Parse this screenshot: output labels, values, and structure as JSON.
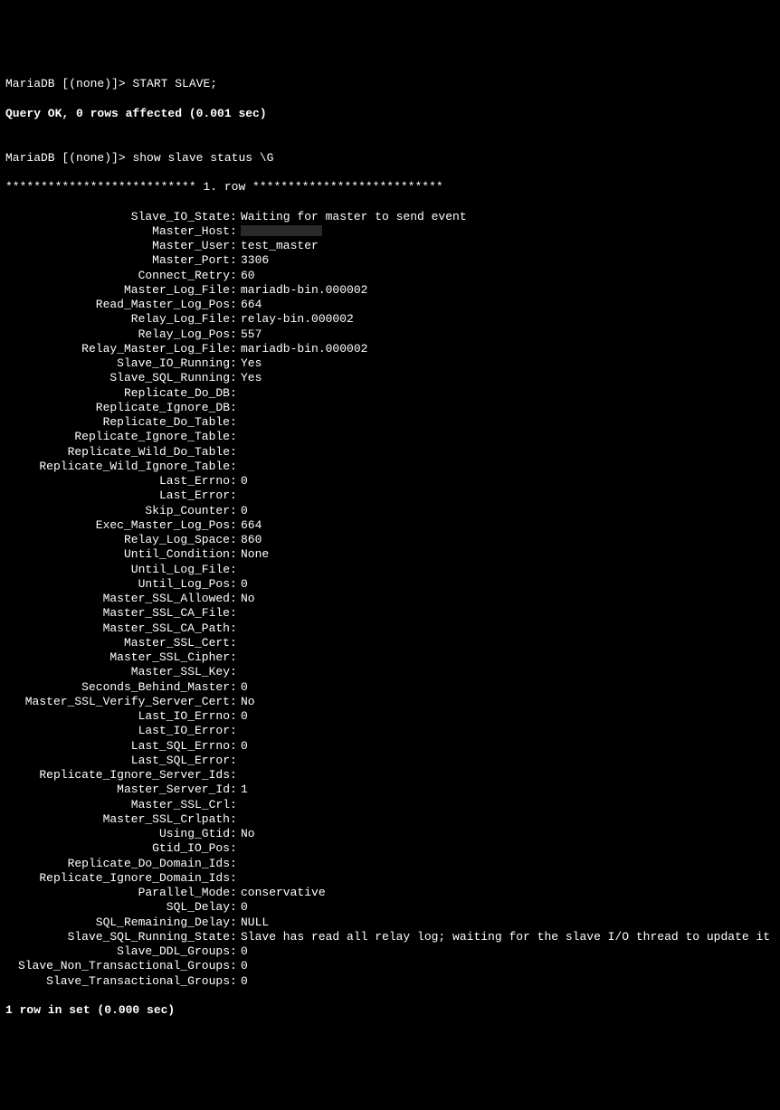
{
  "prompt1": "MariaDB [(none)]> ",
  "cmd1": "START SLAVE;",
  "result1": "Query OK, 0 rows affected (0.001 sec)",
  "blank": "",
  "prompt2": "MariaDB [(none)]> ",
  "cmd2": "show slave status \\G",
  "row_header": "*************************** 1. row ***************************",
  "fields": [
    {
      "label": "Slave_IO_State",
      "value": "Waiting for master to send event"
    },
    {
      "label": "Master_Host",
      "value": "__REDACTED__"
    },
    {
      "label": "Master_User",
      "value": "test_master"
    },
    {
      "label": "Master_Port",
      "value": "3306"
    },
    {
      "label": "Connect_Retry",
      "value": "60"
    },
    {
      "label": "Master_Log_File",
      "value": "mariadb-bin.000002"
    },
    {
      "label": "Read_Master_Log_Pos",
      "value": "664"
    },
    {
      "label": "Relay_Log_File",
      "value": "relay-bin.000002"
    },
    {
      "label": "Relay_Log_Pos",
      "value": "557"
    },
    {
      "label": "Relay_Master_Log_File",
      "value": "mariadb-bin.000002"
    },
    {
      "label": "Slave_IO_Running",
      "value": "Yes"
    },
    {
      "label": "Slave_SQL_Running",
      "value": "Yes"
    },
    {
      "label": "Replicate_Do_DB",
      "value": ""
    },
    {
      "label": "Replicate_Ignore_DB",
      "value": ""
    },
    {
      "label": "Replicate_Do_Table",
      "value": ""
    },
    {
      "label": "Replicate_Ignore_Table",
      "value": ""
    },
    {
      "label": "Replicate_Wild_Do_Table",
      "value": ""
    },
    {
      "label": "Replicate_Wild_Ignore_Table",
      "value": ""
    },
    {
      "label": "Last_Errno",
      "value": "0"
    },
    {
      "label": "Last_Error",
      "value": ""
    },
    {
      "label": "Skip_Counter",
      "value": "0"
    },
    {
      "label": "Exec_Master_Log_Pos",
      "value": "664"
    },
    {
      "label": "Relay_Log_Space",
      "value": "860"
    },
    {
      "label": "Until_Condition",
      "value": "None"
    },
    {
      "label": "Until_Log_File",
      "value": ""
    },
    {
      "label": "Until_Log_Pos",
      "value": "0"
    },
    {
      "label": "Master_SSL_Allowed",
      "value": "No"
    },
    {
      "label": "Master_SSL_CA_File",
      "value": ""
    },
    {
      "label": "Master_SSL_CA_Path",
      "value": ""
    },
    {
      "label": "Master_SSL_Cert",
      "value": ""
    },
    {
      "label": "Master_SSL_Cipher",
      "value": ""
    },
    {
      "label": "Master_SSL_Key",
      "value": ""
    },
    {
      "label": "Seconds_Behind_Master",
      "value": "0"
    },
    {
      "label": "Master_SSL_Verify_Server_Cert",
      "value": "No"
    },
    {
      "label": "Last_IO_Errno",
      "value": "0"
    },
    {
      "label": "Last_IO_Error",
      "value": ""
    },
    {
      "label": "Last_SQL_Errno",
      "value": "0"
    },
    {
      "label": "Last_SQL_Error",
      "value": ""
    },
    {
      "label": "Replicate_Ignore_Server_Ids",
      "value": ""
    },
    {
      "label": "Master_Server_Id",
      "value": "1"
    },
    {
      "label": "Master_SSL_Crl",
      "value": ""
    },
    {
      "label": "Master_SSL_Crlpath",
      "value": ""
    },
    {
      "label": "Using_Gtid",
      "value": "No"
    },
    {
      "label": "Gtid_IO_Pos",
      "value": ""
    },
    {
      "label": "Replicate_Do_Domain_Ids",
      "value": ""
    },
    {
      "label": "Replicate_Ignore_Domain_Ids",
      "value": ""
    },
    {
      "label": "Parallel_Mode",
      "value": "conservative"
    },
    {
      "label": "SQL_Delay",
      "value": "0"
    },
    {
      "label": "SQL_Remaining_Delay",
      "value": "NULL"
    },
    {
      "label": "Slave_SQL_Running_State",
      "value": "Slave has read all relay log; waiting for the slave I/O thread to update it"
    },
    {
      "label": "Slave_DDL_Groups",
      "value": "0"
    },
    {
      "label": "Slave_Non_Transactional_Groups",
      "value": "0"
    },
    {
      "label": "Slave_Transactional_Groups",
      "value": "0"
    }
  ],
  "footer": "1 row in set (0.000 sec)"
}
